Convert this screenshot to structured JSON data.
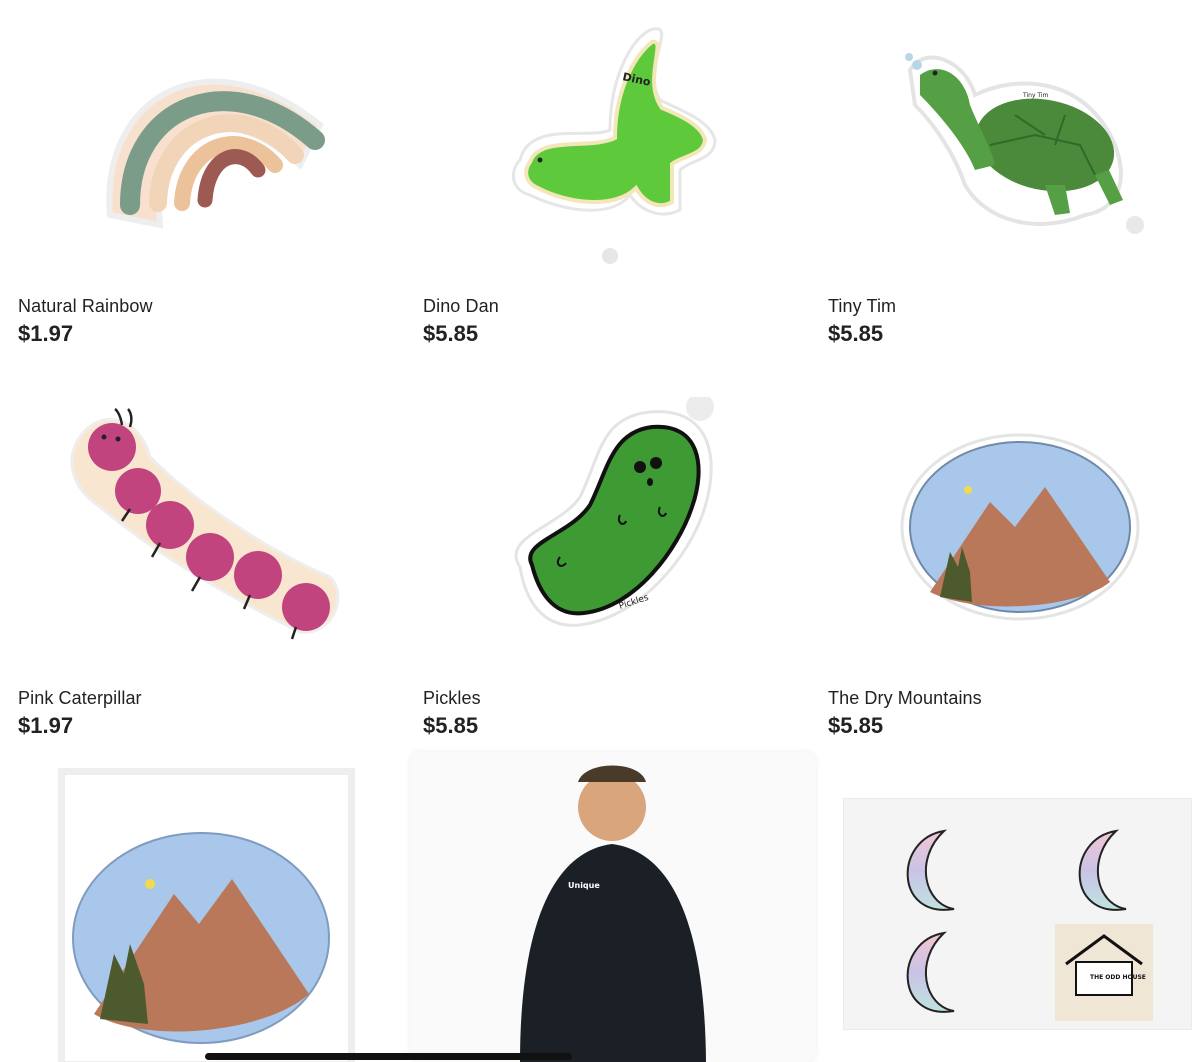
{
  "products": [
    {
      "name": "Natural Rainbow",
      "price": "$1.97",
      "icon": "rainbow-sticker"
    },
    {
      "name": "Dino Dan",
      "price": "$5.85",
      "icon": "dinosaur-sticker",
      "sticker_text": "Dino"
    },
    {
      "name": "Tiny Tim",
      "price": "$5.85",
      "icon": "turtle-sticker",
      "sticker_text": "Tiny Tim"
    },
    {
      "name": "Pink Caterpillar",
      "price": "$1.97",
      "icon": "caterpillar-sticker"
    },
    {
      "name": "Pickles",
      "price": "$5.85",
      "icon": "pickle-sticker",
      "sticker_text": "Pickles"
    },
    {
      "name": "The Dry Mountains",
      "price": "$5.85",
      "icon": "mountains-sticker"
    }
  ],
  "bottom_row": [
    {
      "icon": "mountains-print-image"
    },
    {
      "icon": "hoodie-model-image",
      "shirt_text": "Unique"
    },
    {
      "icon": "moon-sticker-sheet-image",
      "logo_text": "THE ODD HOUSE"
    }
  ],
  "colors": {
    "price_text": "#222222",
    "dino_green": "#5ec93a",
    "turtle_green": "#3f8f37",
    "caterpillar_pink": "#c2447e",
    "pickle_green": "#3e9a32",
    "hoodie_black": "#1b1f26"
  }
}
